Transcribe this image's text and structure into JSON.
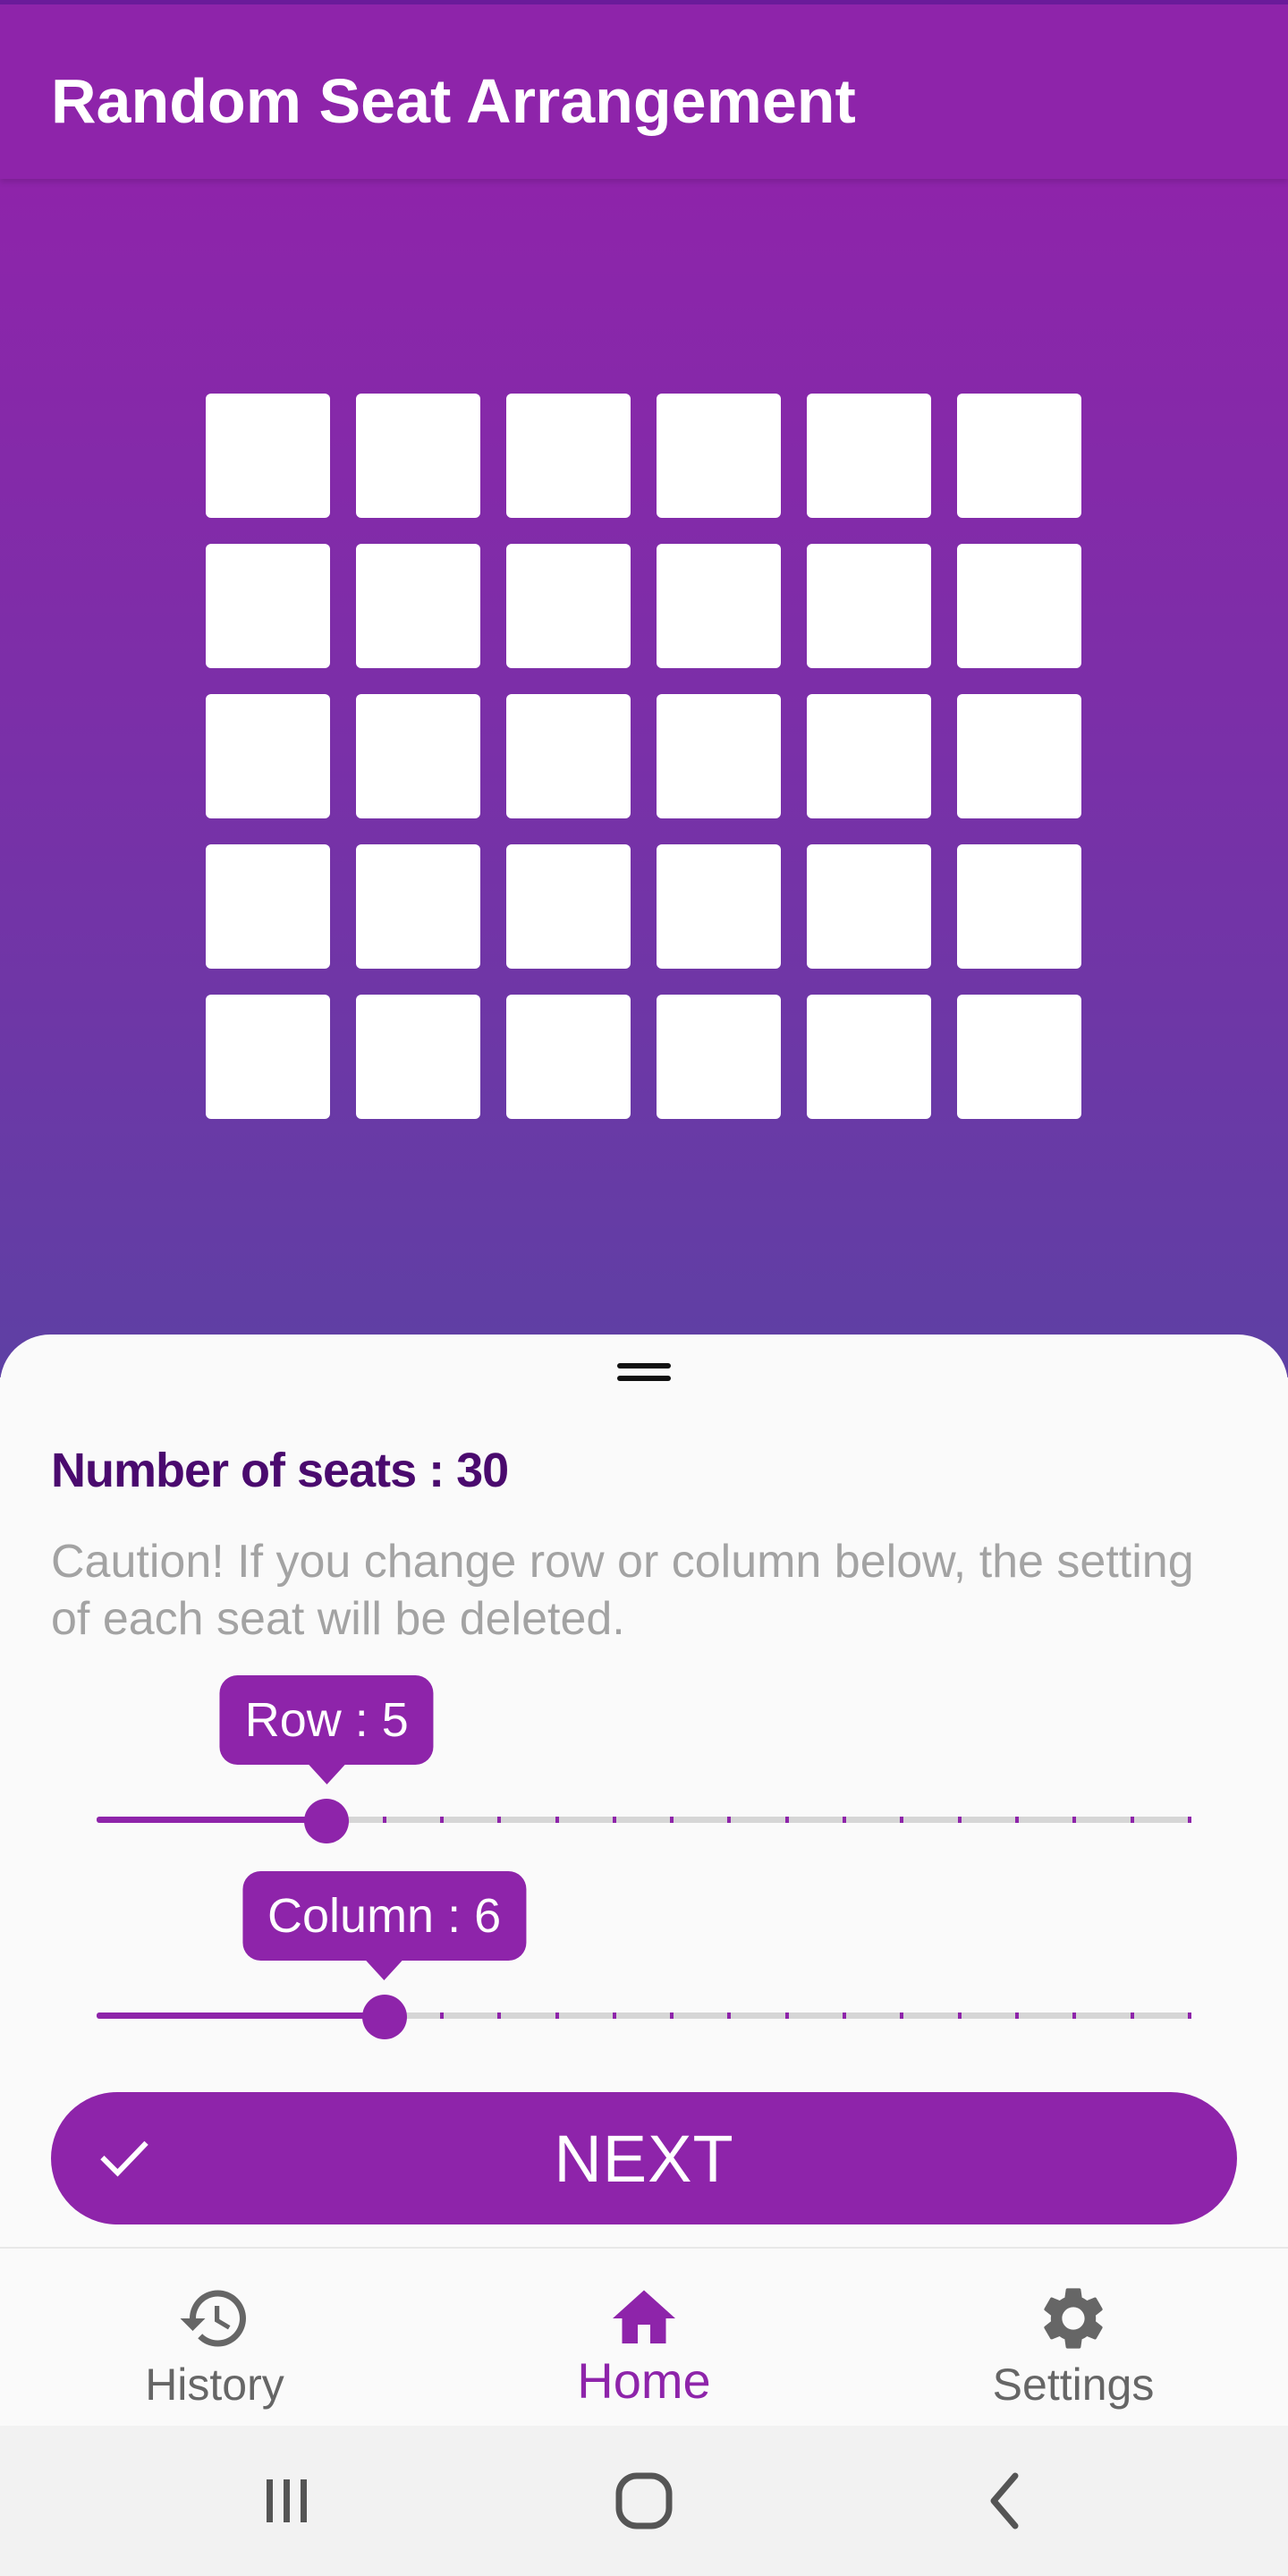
{
  "app_bar": {
    "title": "Random Seat Arrangement"
  },
  "seat_grid": {
    "rows": 5,
    "columns": 6
  },
  "sheet": {
    "seat_count_label": "Number of seats : 30",
    "caution_text": "Caution! If you change row or column below, the setting of each seat will be deleted.",
    "row_slider": {
      "label": "Row : 5",
      "value": 5,
      "min": 1,
      "max": 20
    },
    "column_slider": {
      "label": "Column : 6",
      "value": 6,
      "min": 1,
      "max": 20
    },
    "next_button": {
      "label": "NEXT",
      "icon": "check-icon"
    }
  },
  "bottom_nav": {
    "items": [
      {
        "label": "History",
        "icon": "history-icon",
        "active": false
      },
      {
        "label": "Home",
        "icon": "home-icon",
        "active": true
      },
      {
        "label": "Settings",
        "icon": "gear-icon",
        "active": false
      }
    ]
  },
  "system_nav": {
    "buttons": [
      "recents-icon",
      "home-circle-icon",
      "back-icon"
    ]
  },
  "colors": {
    "primary": "#8e24aa",
    "dark_text": "#4a0a6e",
    "muted_text": "#a3a3a3"
  }
}
